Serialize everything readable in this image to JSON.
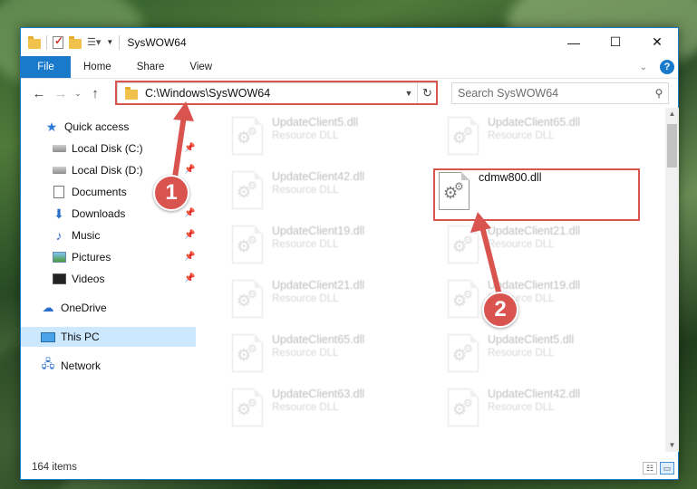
{
  "window": {
    "title": "SysWOW64",
    "minimize_label": "—",
    "maximize_label": "☐",
    "close_label": "✕"
  },
  "ribbon": {
    "tabs": [
      "File",
      "Home",
      "Share",
      "View"
    ]
  },
  "navigation": {
    "back": "←",
    "forward": "→",
    "recent": "⌄",
    "up": "↑",
    "address": "C:\\Windows\\SysWOW64",
    "refresh": "↻",
    "search_placeholder": "Search SysWOW64"
  },
  "sidebar": {
    "items": [
      {
        "label": "Quick access",
        "icon": "star-icon",
        "pinned": false
      },
      {
        "label": "Local Disk (C:)",
        "icon": "drive-icon",
        "pinned": true
      },
      {
        "label": "Local Disk (D:)",
        "icon": "drive-icon",
        "pinned": true
      },
      {
        "label": "Documents",
        "icon": "documents-icon",
        "pinned": true
      },
      {
        "label": "Downloads",
        "icon": "downloads-icon",
        "pinned": true
      },
      {
        "label": "Music",
        "icon": "music-icon",
        "pinned": true
      },
      {
        "label": "Pictures",
        "icon": "pictures-icon",
        "pinned": true
      },
      {
        "label": "Videos",
        "icon": "videos-icon",
        "pinned": true
      },
      {
        "label": "OneDrive",
        "icon": "cloud-icon",
        "pinned": false
      },
      {
        "label": "This PC",
        "icon": "computer-icon",
        "pinned": false,
        "selected": true
      },
      {
        "label": "Network",
        "icon": "network-icon",
        "pinned": false
      }
    ]
  },
  "files": [
    {
      "name": "UpdateClient5.dll",
      "type": "Resource DLL",
      "faded": true
    },
    {
      "name": "UpdateClient65.dll",
      "type": "Resource DLL",
      "faded": true
    },
    {
      "name": "UpdateClient42.dll",
      "type": "Resource DLL",
      "faded": true
    },
    {
      "name": "cdmw800.dll",
      "type": "",
      "faded": false
    },
    {
      "name": "UpdateClient19.dll",
      "type": "Resource DLL",
      "faded": true
    },
    {
      "name": "UpdateClient21.dll",
      "type": "Resource DLL",
      "faded": true
    },
    {
      "name": "UpdateClient21.dll",
      "type": "Resource DLL",
      "faded": true
    },
    {
      "name": "UpdateClient19.dll",
      "type": "Resource DLL",
      "faded": true
    },
    {
      "name": "UpdateClient65.dll",
      "type": "Resource DLL",
      "faded": true
    },
    {
      "name": "UpdateClient5.dll",
      "type": "Resource DLL",
      "faded": true
    },
    {
      "name": "UpdateClient63.dll",
      "type": "Resource DLL",
      "faded": true
    },
    {
      "name": "UpdateClient42.dll",
      "type": "Resource DLL",
      "faded": true
    }
  ],
  "status": {
    "item_count": "164 items"
  },
  "annotations": {
    "step1": "1",
    "step2": "2",
    "color": "#d9534f"
  }
}
